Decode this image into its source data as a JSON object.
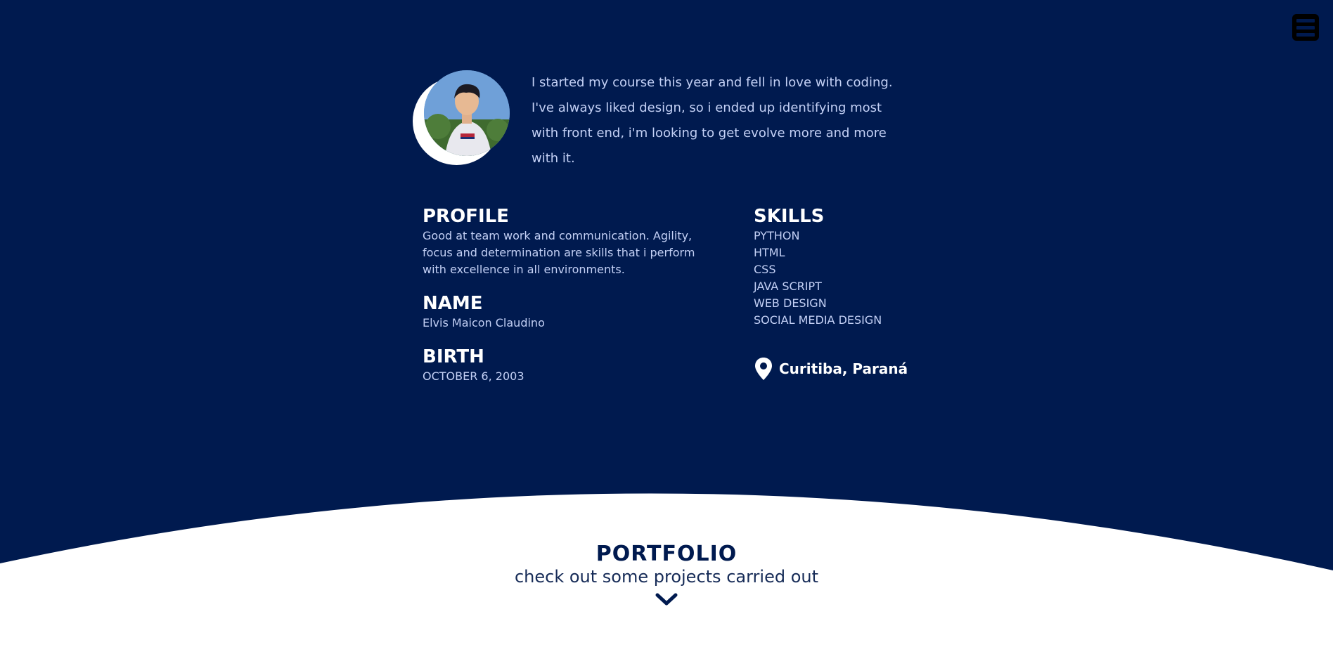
{
  "theme": {
    "navy": "#001a4f",
    "light_text": "#c3d0f5",
    "white": "#ffffff"
  },
  "header": {
    "menu_icon": "hamburger-menu-icon"
  },
  "about": {
    "avatar_alt": "profile photo",
    "intro": "I started my course this year and fell in love with coding. I've always liked design, so i ended up identifying most with front end, i'm looking to get evolve more and more with it."
  },
  "profile": {
    "heading": "PROFILE",
    "text": "Good at team work and communication. Agility, focus and determination are skills that i perform with excellence in all environments."
  },
  "name": {
    "heading": "NAME",
    "value": "Elvis Maicon Claudino"
  },
  "birth": {
    "heading": "BIRTH",
    "value": "OCTOBER 6, 2003"
  },
  "skills": {
    "heading": "SKILLS",
    "items": [
      "PYTHON",
      "HTML",
      "CSS",
      "JAVA SCRIPT",
      "WEB DESIGN",
      "SOCIAL MEDIA DESIGN"
    ]
  },
  "location": {
    "icon": "map-pin-icon",
    "city": "Curitiba, Paraná"
  },
  "portfolio": {
    "title": "PORTFOLIO",
    "subtitle": "check out some projects carried out",
    "icon": "chevron-down-icon"
  }
}
